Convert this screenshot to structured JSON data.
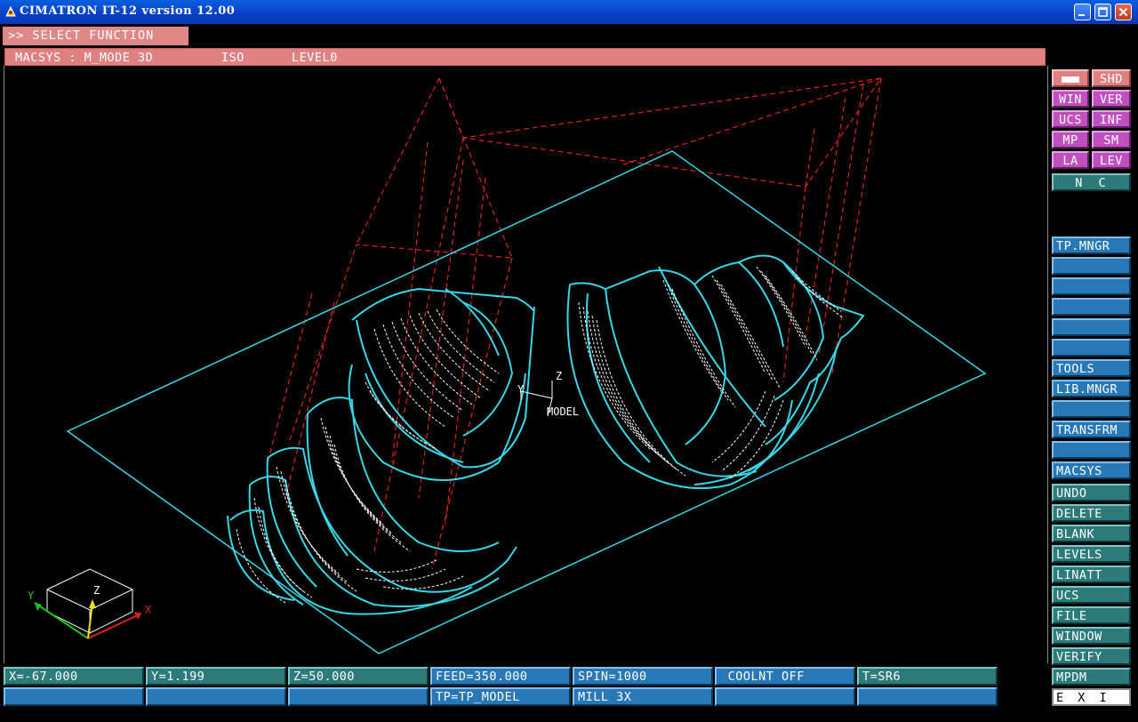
{
  "window": {
    "title": "CIMATRON IT-12 version 12.00",
    "app_icon": "cimatron-app-icon",
    "controls": [
      "minimize-icon",
      "maximize-icon",
      "close-icon"
    ]
  },
  "prompt": {
    "text": ">> SELECT FUNCTION"
  },
  "status_line": {
    "macsys": "MACSYS : M_MODE 3D",
    "view": "ISO",
    "level": "LEVEL0"
  },
  "viewport": {
    "model_label": "MODEL",
    "axis_y": "Y",
    "axis_z": "Z",
    "triad_x": "X",
    "triad_y": "Y",
    "triad_z": "Z",
    "colors": {
      "geometry": "#36d8e8",
      "toolpath": "#ffffff",
      "stock": "#e02020",
      "background": "#000000"
    }
  },
  "right_panel": {
    "top_grid": [
      {
        "label": "",
        "style": "pink",
        "name": "color-swatch-button",
        "icon": "white-swatch"
      },
      {
        "label": "SHD",
        "style": "pink",
        "name": "shd-button"
      },
      {
        "label": "WIN",
        "style": "mag",
        "name": "win-button"
      },
      {
        "label": "VER",
        "style": "mag",
        "name": "ver-button"
      },
      {
        "label": "UCS",
        "style": "mag",
        "name": "ucs-toggle-button"
      },
      {
        "label": "INF",
        "style": "mag",
        "name": "inf-button"
      },
      {
        "label": "MP",
        "style": "mag",
        "name": "mp-button"
      },
      {
        "label": "SM",
        "style": "mag",
        "name": "sm-button"
      },
      {
        "label": "LA",
        "style": "mag",
        "name": "la-button"
      },
      {
        "label": "LEV",
        "style": "mag",
        "name": "lev-button"
      }
    ],
    "nc": "N C",
    "blue_items": [
      "TP.MNGR",
      "",
      "",
      "",
      "",
      "",
      "TOOLS",
      "LIB.MNGR",
      "",
      "TRANSFRM",
      "",
      "MACSYS"
    ],
    "teal_items": [
      "UNDO",
      "DELETE",
      "BLANK",
      "LEVELS",
      "LINATT",
      "UCS",
      "FILE",
      "WINDOW",
      "VERIFY",
      "MPDM"
    ],
    "exit": "E X I T"
  },
  "bottom_bar": {
    "row1": [
      "X=-67.000",
      "Y=1.199",
      "Z=50.000",
      "FEED=350.000",
      "SPIN=1000",
      " COOLNT OFF",
      "T=SR6"
    ],
    "row2": [
      "",
      "",
      "",
      "TP=TP_MODEL",
      "MILL 3X",
      "",
      ""
    ]
  }
}
